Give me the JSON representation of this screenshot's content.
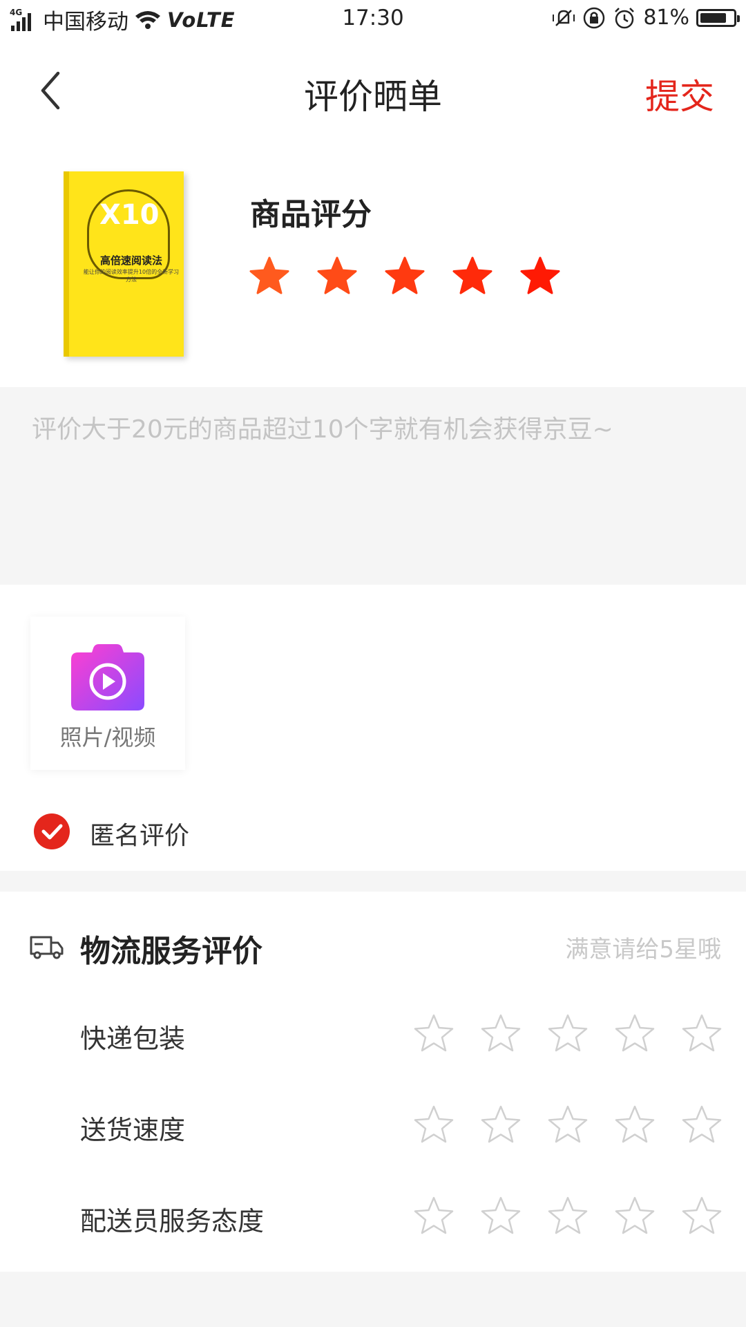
{
  "status_bar": {
    "network_tag": "4G",
    "carrier": "中国移动",
    "volte": "VoLTE",
    "time": "17:30",
    "battery": "81%",
    "battery_level": 0.81
  },
  "nav": {
    "title": "评价晒单",
    "submit_label": "提交"
  },
  "product": {
    "cover": {
      "title": "高倍速阅读法",
      "subtitle": "能让你的阅读效率提升10倍的全新学习方法",
      "x10": "X10"
    },
    "rating_label": "商品评分",
    "rating": 5,
    "star_colors": [
      "#ff5a1e",
      "#ff4b17",
      "#ff3a10",
      "#ff2a0a",
      "#ff1a04"
    ]
  },
  "comment": {
    "placeholder": "评价大于20元的商品超过10个字就有机会获得京豆~",
    "value": ""
  },
  "media": {
    "upload_label": "照片/视频"
  },
  "anonymous": {
    "label": "匿名评价",
    "checked": true
  },
  "logistics": {
    "title": "物流服务评价",
    "hint": "满意请给5星哦",
    "rows": [
      {
        "label": "快递包装",
        "rating": 0
      },
      {
        "label": "送货速度",
        "rating": 0
      },
      {
        "label": "配送员服务态度",
        "rating": 0
      }
    ]
  },
  "colors": {
    "accent": "#e4261c",
    "page_bg": "#f5f5f5"
  }
}
